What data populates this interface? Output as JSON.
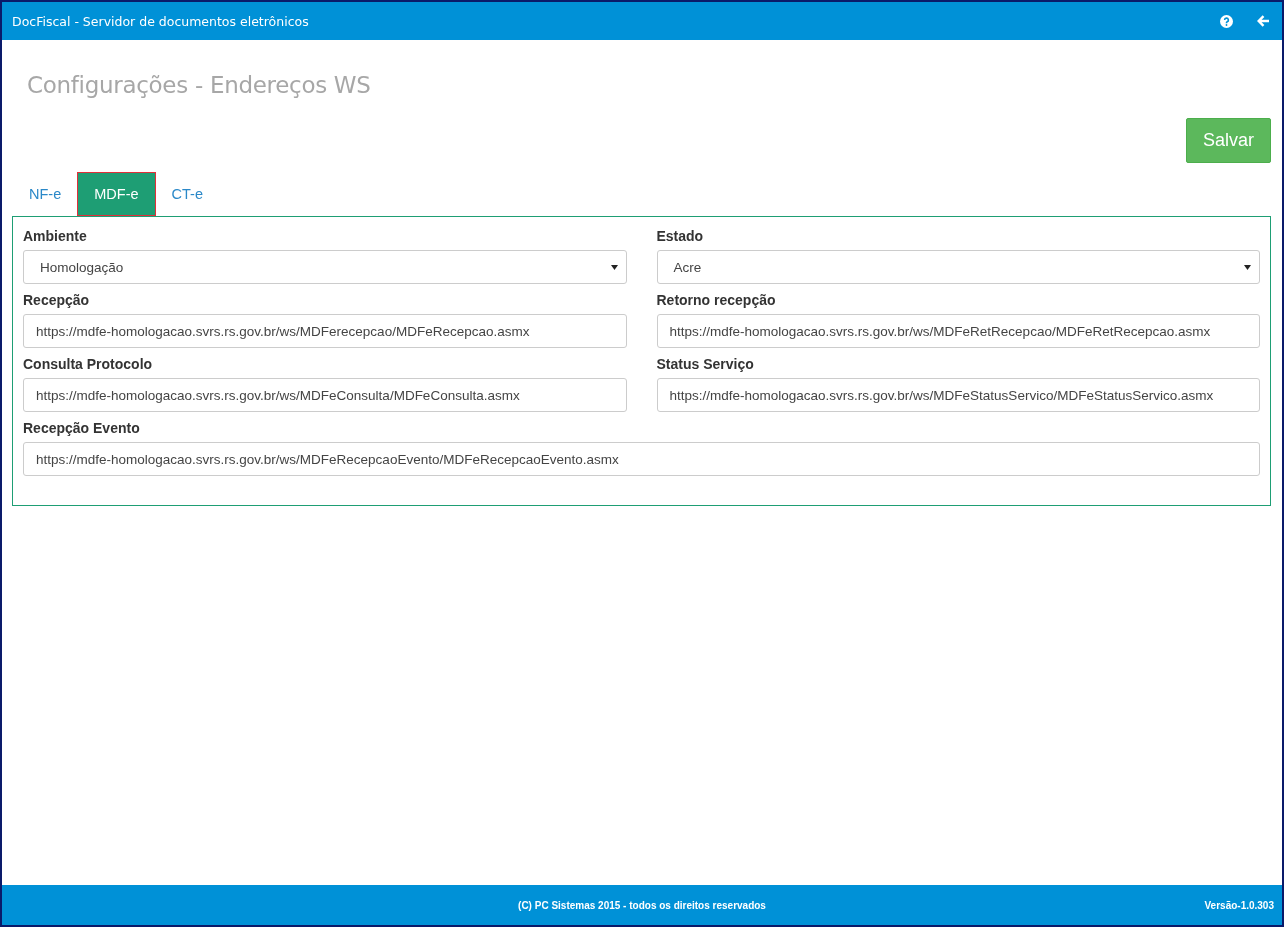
{
  "window": {
    "title": "DocFiscal - Servidor de documentos eletrônicos"
  },
  "page_title": "Configurações - Endereços WS",
  "save_button": "Salvar",
  "tabs": [
    {
      "label": "NF-e",
      "selected": false
    },
    {
      "label": "MDF-e",
      "selected": true
    },
    {
      "label": "CT-e",
      "selected": false
    }
  ],
  "fields": [
    {
      "label": "Ambiente",
      "kind": "select",
      "value": "Homologação"
    },
    {
      "label": "Estado",
      "kind": "select",
      "value": "Acre"
    },
    {
      "label": "Recepção",
      "kind": "text",
      "value": "https://mdfe-homologacao.svrs.rs.gov.br/ws/MDFerecepcao/MDFeRecepcao.asmx"
    },
    {
      "label": "Retorno recepção",
      "kind": "text",
      "value": "https://mdfe-homologacao.svrs.rs.gov.br/ws/MDFeRetRecepcao/MDFeRetRecepcao.asmx"
    },
    {
      "label": "Consulta Protocolo",
      "kind": "text",
      "value": "https://mdfe-homologacao.svrs.rs.gov.br/ws/MDFeConsulta/MDFeConsulta.asmx"
    },
    {
      "label": "Status Serviço",
      "kind": "text",
      "value": "https://mdfe-homologacao.svrs.rs.gov.br/ws/MDFeStatusServico/MDFeStatusServico.asmx"
    },
    {
      "label": "Recepção Evento",
      "kind": "text",
      "value": "https://mdfe-homologacao.svrs.rs.gov.br/ws/MDFeRecepcaoEvento/MDFeRecepcaoEvento.asmx"
    }
  ],
  "footer": {
    "copyright": "(C) PC Sistemas 2015 - todos os direitos reservados",
    "version": "Versão-1.0.303"
  }
}
